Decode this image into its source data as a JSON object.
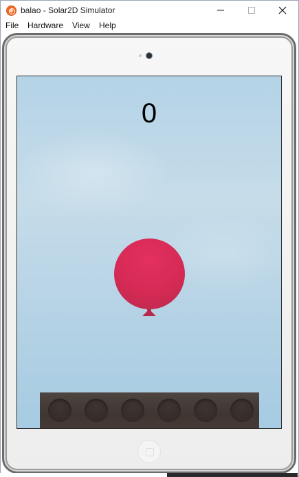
{
  "window": {
    "title": "balao - Solar2D Simulator",
    "controls": {
      "minimize": "minimize-icon",
      "maximize": "maximize-icon",
      "close": "close-icon"
    }
  },
  "menu": {
    "items": [
      "File",
      "Hardware",
      "View",
      "Help"
    ]
  },
  "device": {
    "type": "tablet",
    "frame_color": "#f2f2f2"
  },
  "game": {
    "score": "0",
    "sky_color": "#b8d5e8",
    "balloon_color": "#d62a55",
    "platform_color": "#453a36",
    "platform_holes": 6
  }
}
